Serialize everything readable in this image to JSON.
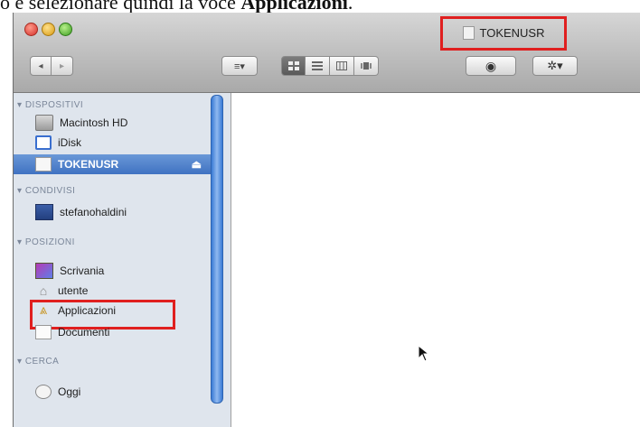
{
  "caption": {
    "prefix": "o e selezionare quindi la voce ",
    "bold": "Applicazioni",
    "suffix": "."
  },
  "window": {
    "title": "TOKENUSR",
    "traffic_lights": [
      "close",
      "minimize",
      "zoom"
    ]
  },
  "toolbar": {
    "nav": [
      "◂",
      "▸"
    ],
    "arrange_label": "≡▾",
    "view_modes": [
      "icon-view",
      "list-view",
      "column-view",
      "coverflow-view"
    ],
    "quicklook_label": "◉",
    "action_label": "✲▾"
  },
  "sidebar": {
    "sections": [
      {
        "header": "DISPOSITIVI",
        "items": [
          {
            "label": "Macintosh HD",
            "icon": "hard-drive-icon"
          },
          {
            "label": "iDisk",
            "icon": "idisk-icon"
          },
          {
            "label": "TOKENUSR",
            "icon": "token-drive-icon",
            "selected": true,
            "eject": "⏏"
          }
        ]
      },
      {
        "header": "CONDIVISI",
        "items": [
          {
            "label": "stefanohaldini",
            "icon": "shared-computer-icon"
          }
        ]
      },
      {
        "header": "POSIZIONI",
        "items": [
          {
            "label": "Scrivania",
            "icon": "desktop-icon"
          },
          {
            "label": "utente",
            "icon": "home-icon"
          },
          {
            "label": "Applicazioni",
            "icon": "applications-icon",
            "highlighted": true
          },
          {
            "label": "Documenti",
            "icon": "documents-icon"
          }
        ]
      },
      {
        "header": "CERCA",
        "items": [
          {
            "label": "Oggi",
            "icon": "clock-icon"
          }
        ]
      }
    ]
  },
  "colors": {
    "highlight_box": "#e01f1f",
    "selection": "#3f72c2",
    "sidebar_bg": "#dfe5ed"
  }
}
